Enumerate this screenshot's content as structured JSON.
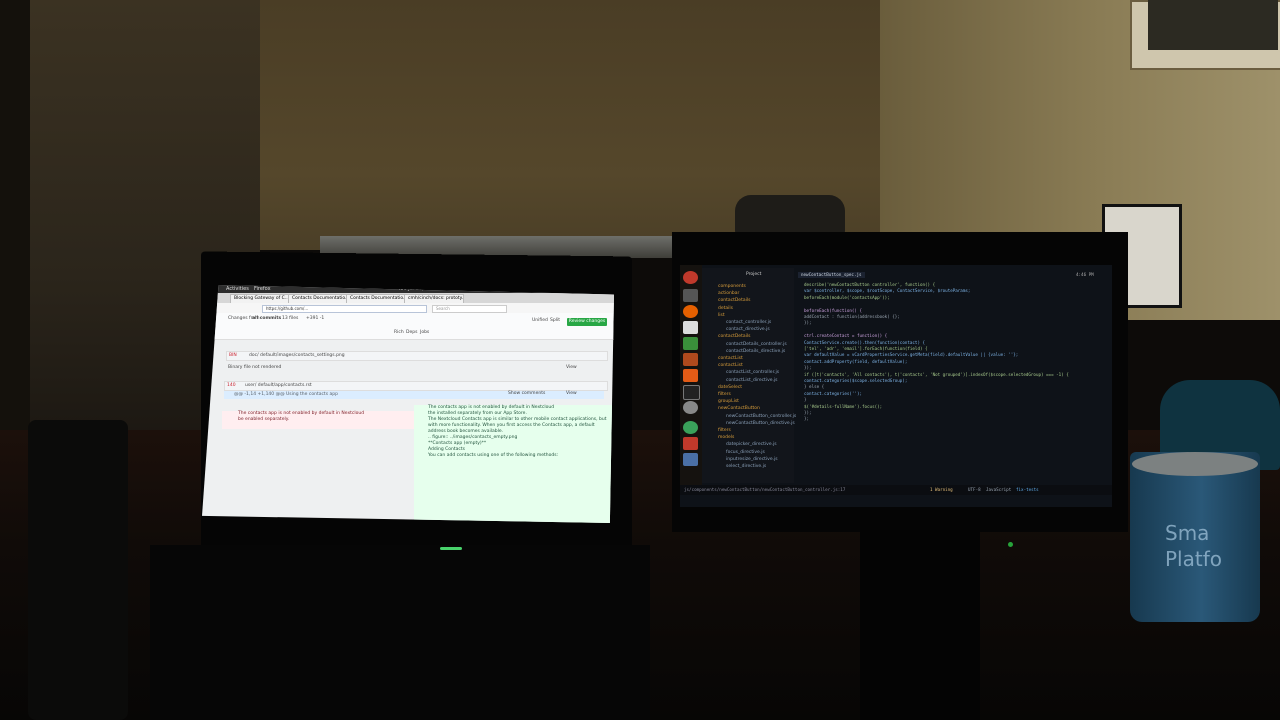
{
  "laptop": {
    "activities": "Activities",
    "app": "Firefox",
    "clock": "Tue Jul 26, 10:49:20",
    "tabs": [
      "Blocking Gateway of C...",
      "Contacts Documentatio...",
      "Contacts Documentatio...",
      "cmh/cinch/docs: prototy..."
    ],
    "url": "https://github.com/...",
    "search_placeholder": "Search",
    "changes_from": "Changes from",
    "all_commits": "all commits",
    "files": "13 files",
    "diffstat": "+391 -1",
    "unified": "Unified",
    "split": "Split",
    "review_button": "Review changes",
    "tabs_row": [
      "Rich",
      "Deps",
      "Jobs"
    ],
    "file1_stat": "BIN",
    "file1_path": "doc/ default/images/contacts_settings.png",
    "file1_note": "Binary file not rendered",
    "view": "View",
    "file2_stat": "140",
    "file2_path": "user/ default/app/contacts.rst",
    "hunk": "@@ -1,14 +1,140 @@ Using the contacts app",
    "show_comments": "Show comments",
    "left_lines": [
      "The contacts app is not enabled by default in Nextcloud ",
      "be enabled separately."
    ],
    "right_lines": [
      "The contacts app is not enabled by default in Nextcloud ",
      "the installed separately from our App Store.",
      "",
      "The Nextcloud Contacts app is similar to other mobile contact applications, but",
      "with more functionality. When you first access the Contacts app, a default",
      "address book becomes available.",
      "",
      ".. figure:: ../images/contacts_empty.png",
      "",
      "**Contacts app (empty)**",
      "",
      "Adding Contacts",
      "",
      "You can add contacts using one of the following methods:"
    ]
  },
  "monitor": {
    "project_label": "Project",
    "tab_title": "newContactButton_spec.js",
    "clock": "4:46 PM",
    "tree": [
      {
        "label": "components",
        "folder": true
      },
      {
        "label": "actionbar",
        "folder": true
      },
      {
        "label": "contactDetails",
        "folder": true
      },
      {
        "label": "details",
        "folder": true
      },
      {
        "label": "list",
        "folder": true
      },
      {
        "label": "contact_controller.js",
        "folder": false
      },
      {
        "label": "contact_directive.js",
        "folder": false
      },
      {
        "label": "contactDetails",
        "folder": true
      },
      {
        "label": "contactDetails_controller.js",
        "folder": false
      },
      {
        "label": "contactDetails_directive.js",
        "folder": false
      },
      {
        "label": "contactList",
        "folder": true
      },
      {
        "label": "contactList",
        "folder": true
      },
      {
        "label": "contactList_controller.js",
        "folder": false
      },
      {
        "label": "contactList_directive.js",
        "folder": false
      },
      {
        "label": "dateSelect",
        "folder": true
      },
      {
        "label": "filters",
        "folder": true
      },
      {
        "label": "groupList",
        "folder": true
      },
      {
        "label": "newContactButton",
        "folder": true
      },
      {
        "label": "newContactButton_controller.js",
        "folder": false
      },
      {
        "label": "newContactButton_directive.js",
        "folder": false
      },
      {
        "label": "filters",
        "folder": true
      },
      {
        "label": "models",
        "folder": true
      },
      {
        "label": "datepicker_directive.js",
        "folder": false
      },
      {
        "label": "focus_directive.js",
        "folder": false
      },
      {
        "label": "inputresize_directive.js",
        "folder": false
      },
      {
        "label": "select_directive.js",
        "folder": false
      }
    ],
    "code": [
      "describe('newContactButton controller', function() {",
      "  var $controller, $scope, $rootScope, ContactService, $routeParams;",
      "  beforeEach(module('contactsApp'));",
      "",
      "  beforeEach(function() {",
      "    addContact : function(addressbook) {};",
      "  });",
      "",
      "  ctrl.createContact = function() {",
      "    ContactService.create().then(function(contact) {",
      "      ['tel', 'adr', 'email'].forEach(function(field) {",
      "        var defaultValue = vCardPropertiesService.getMeta(field).defaultValue || {value: ''};",
      "        contact.addProperty(field, defaultValue);",
      "      });",
      "      if ([t('contacts', 'All contacts'), t('contacts', 'Not grouped')].indexOf($scope.selectedGroup) === -1) {",
      "        contact.categories($scope.selectedGroup);",
      "      } else {",
      "        contact.categories('');",
      "      }",
      "      $('#details-fullName').focus();",
      "    });",
      "  };"
    ],
    "status_path": "js/components/newContactButton/newContactButton_controller.js:17",
    "status_right": [
      "1 Warning",
      "UTF-8",
      "JavaScript",
      "fix-tests"
    ]
  },
  "room": {
    "cup_text": "Sma\nPlatfo"
  }
}
